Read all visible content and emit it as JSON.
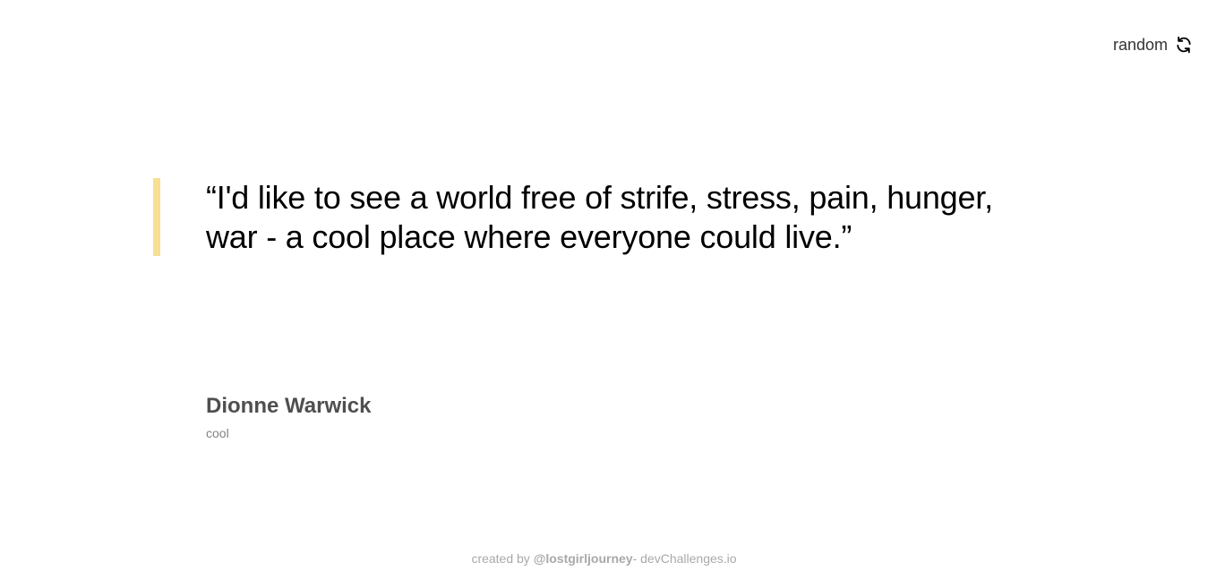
{
  "header": {
    "random_label": "random",
    "refresh_icon": "refresh-icon"
  },
  "quote": {
    "text": "“I'd like to see a world free of strife, stress, pain, hunger, war - a cool place where everyone could live.”",
    "accent_color": "#f7df94"
  },
  "author": {
    "name": "Dionne Warwick",
    "genre": "cool"
  },
  "footer": {
    "created_by": "created by",
    "handle": "@lostgirljourney",
    "site": "- devChallenges.io"
  }
}
